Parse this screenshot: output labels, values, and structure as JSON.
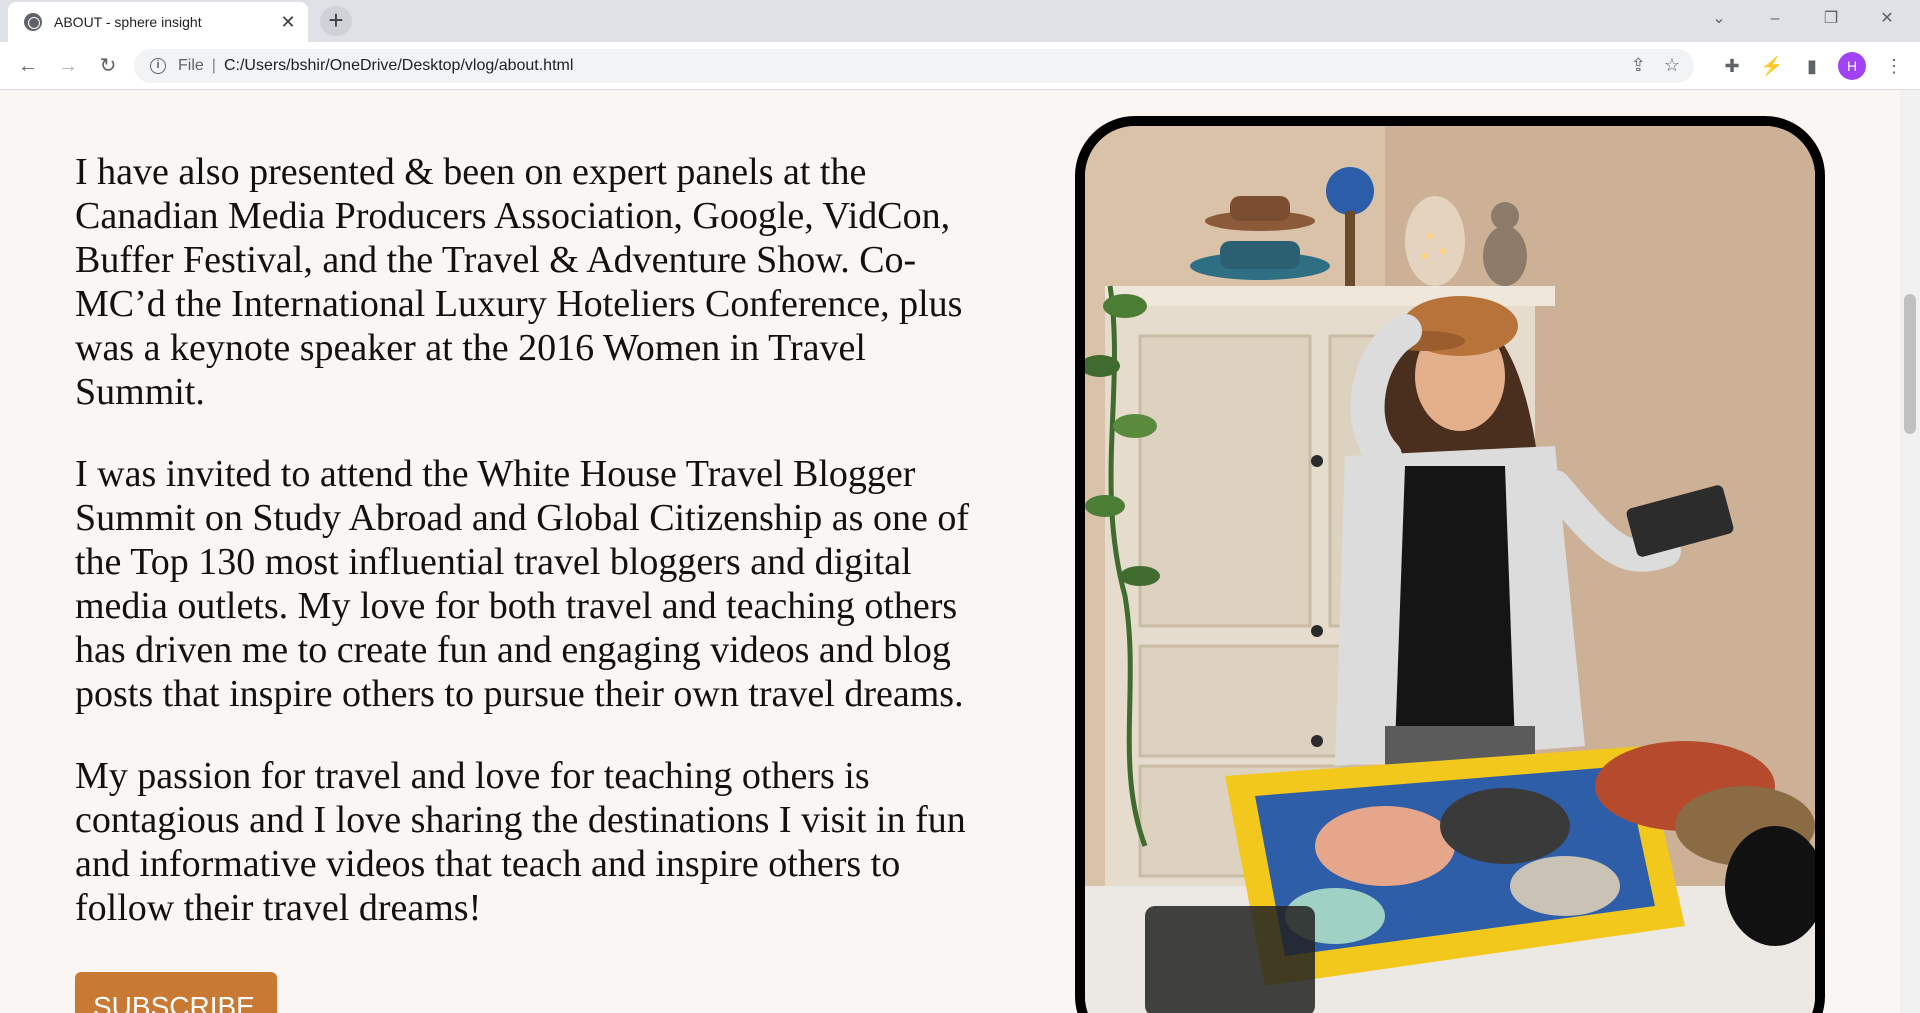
{
  "browser": {
    "tab_title": "ABOUT - sphere insight",
    "scheme": "File",
    "url": "C:/Users/bshir/OneDrive/Desktop/vlog/about.html",
    "profile_initial": "H"
  },
  "content": {
    "paragraphs": [
      "I have also presented & been on expert panels at the Canadian Media Producers Association, Google, VidCon, Buffer Festival, and the Travel & Adventure Show. Co-MC’d the International Luxury Hoteliers Conference, plus was a keynote speaker at the 2016 Women in Travel Summit.",
      "I was invited to attend the White House Travel Blogger Summit on Study Abroad and Global Citizenship as one of the Top 130 most influential travel bloggers and digital media outlets. My love for both travel and teaching others has driven me to create fun and engaging videos and blog posts that inspire others to pursue their own travel dreams.",
      "My passion for travel and love for teaching others is contagious and I love sharing the destinations I visit in fun and informative videos that teach and inspire others to follow their travel dreams!"
    ],
    "subscribe_label": "SUBSCRIBE"
  },
  "colors": {
    "button": "#c87a34",
    "page_bg": "#faf6f3",
    "avatar": "#a142f4"
  },
  "icons": [
    "globe-icon",
    "close-icon",
    "plus-icon",
    "back-icon",
    "forward-icon",
    "reload-icon",
    "info-icon",
    "share-icon",
    "star-icon",
    "puzzle-icon",
    "extension-icon",
    "sidepanel-icon",
    "menu-icon"
  ]
}
